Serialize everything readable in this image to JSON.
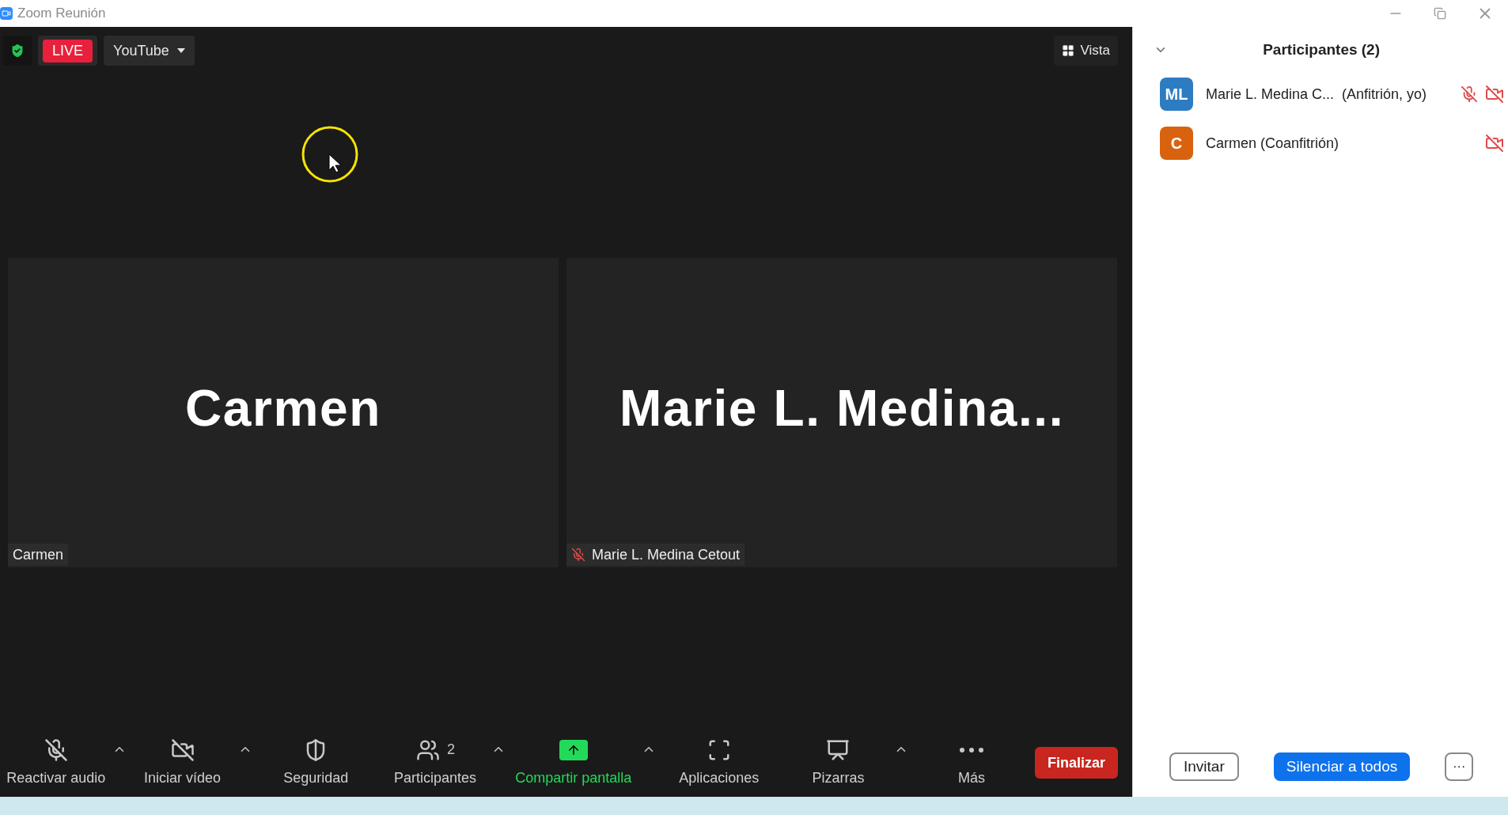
{
  "window": {
    "title": "Zoom Reunión"
  },
  "top_bar": {
    "live": "LIVE",
    "stream": "YouTube",
    "view": "Vista"
  },
  "tiles": [
    {
      "big_name": "Carmen",
      "label": "Carmen",
      "muted": false
    },
    {
      "big_name": "Marie L. Medina...",
      "label": "Marie L. Medina Cetout",
      "muted": true
    }
  ],
  "toolbar": [
    {
      "kind": "mic_off",
      "label": "Reactivar audio",
      "caret": true
    },
    {
      "kind": "video_off",
      "label": "Iniciar vídeo",
      "caret": true
    },
    {
      "kind": "security",
      "label": "Seguridad",
      "caret": false
    },
    {
      "kind": "participants",
      "label": "Participantes",
      "count": "2",
      "caret": true
    },
    {
      "kind": "share",
      "label": "Compartir pantalla",
      "caret": true
    },
    {
      "kind": "apps",
      "label": "Aplicaciones",
      "caret": false
    },
    {
      "kind": "whiteboard",
      "label": "Pizarras",
      "caret": true
    },
    {
      "kind": "more",
      "label": "Más",
      "caret": false
    }
  ],
  "end_button": "Finalizar",
  "panel": {
    "title": "Participantes (2)",
    "participants": [
      {
        "initials": "ML",
        "color": "#2d7cc1",
        "name": "Marie L. Medina C...",
        "role": "(Anfitrión, yo)",
        "audio_muted": true,
        "video_off": true
      },
      {
        "initials": "C",
        "color": "#d9620f",
        "name": "Carmen (Coanfitrión)",
        "audio_muted": false,
        "video_off": true
      }
    ],
    "buttons": {
      "invite": "Invitar",
      "mute_all": "Silenciar a todos",
      "more": "···"
    }
  }
}
